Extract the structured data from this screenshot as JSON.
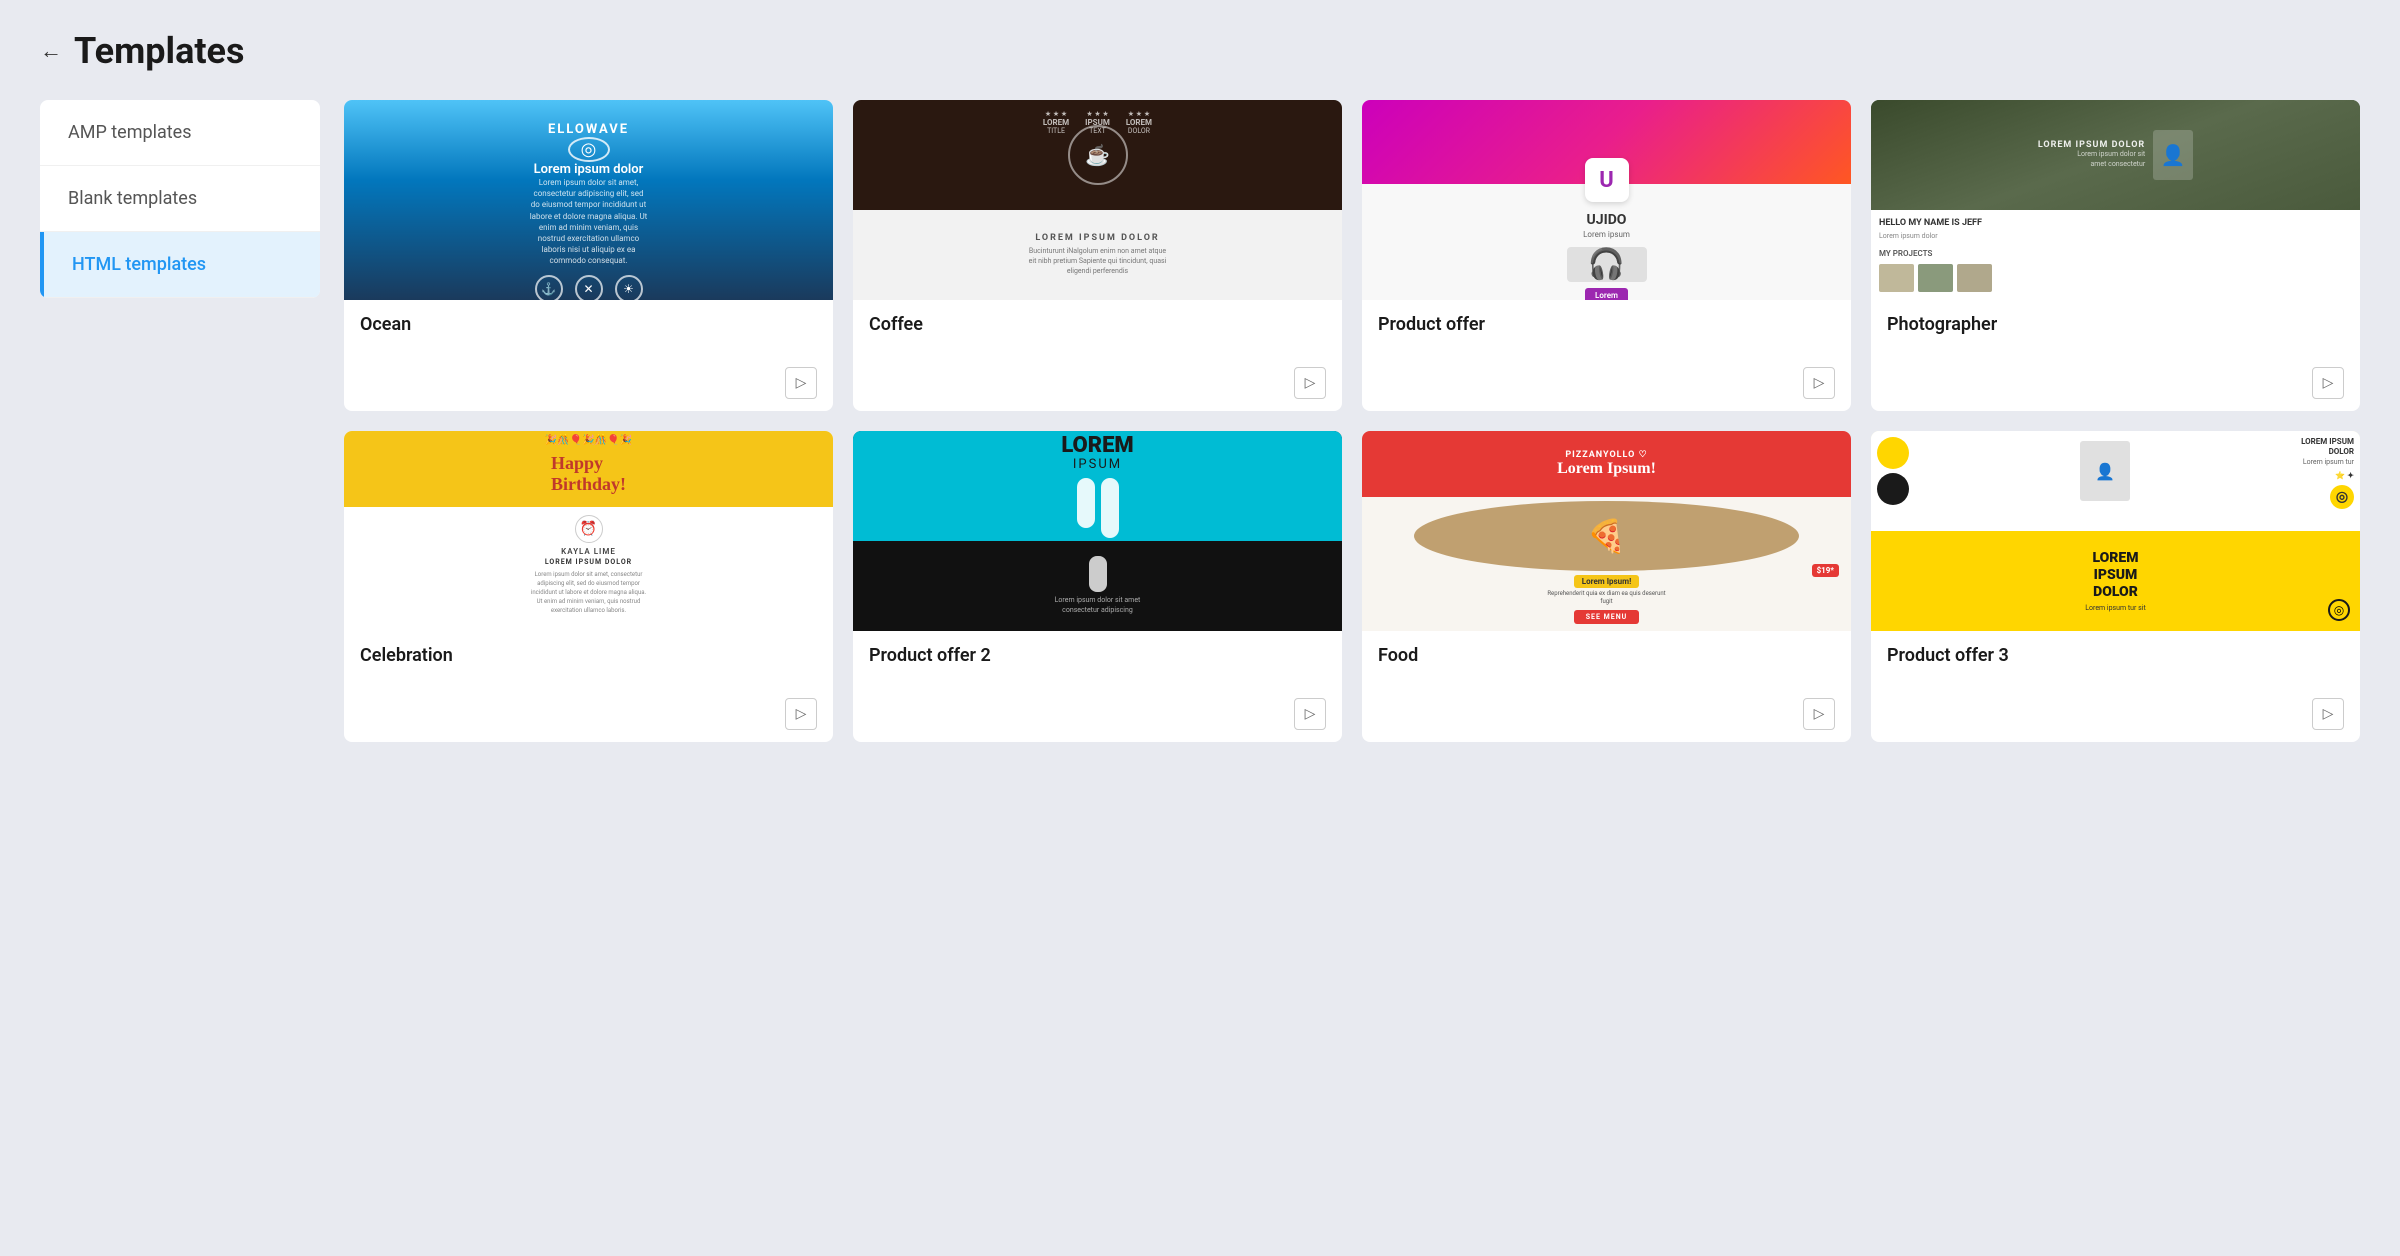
{
  "page": {
    "title": "Templates",
    "back_label": "←"
  },
  "sidebar": {
    "items": [
      {
        "id": "amp",
        "label": "AMP templates",
        "active": false
      },
      {
        "id": "blank",
        "label": "Blank templates",
        "active": false
      },
      {
        "id": "html",
        "label": "HTML templates",
        "active": true
      }
    ]
  },
  "templates": {
    "row1": [
      {
        "id": "ocean",
        "name": "Ocean",
        "thumb_type": "ocean"
      },
      {
        "id": "coffee",
        "name": "Coffee",
        "thumb_type": "coffee"
      },
      {
        "id": "product-offer",
        "name": "Product offer",
        "thumb_type": "product-offer"
      },
      {
        "id": "photographer",
        "name": "Photographer",
        "thumb_type": "photographer"
      }
    ],
    "row2": [
      {
        "id": "celebration",
        "name": "Celebration",
        "thumb_type": "celebration"
      },
      {
        "id": "product-offer-2",
        "name": "Product offer 2",
        "thumb_type": "product2"
      },
      {
        "id": "food",
        "name": "Food",
        "thumb_type": "food"
      },
      {
        "id": "product-offer-3",
        "name": "Product offer 3",
        "thumb_type": "product3"
      }
    ]
  },
  "action_button_label": "▷",
  "colors": {
    "accent": "#2196f3",
    "active_bg": "#e3f2fd",
    "sidebar_bg": "#ffffff",
    "page_bg": "#e8eaf0"
  }
}
